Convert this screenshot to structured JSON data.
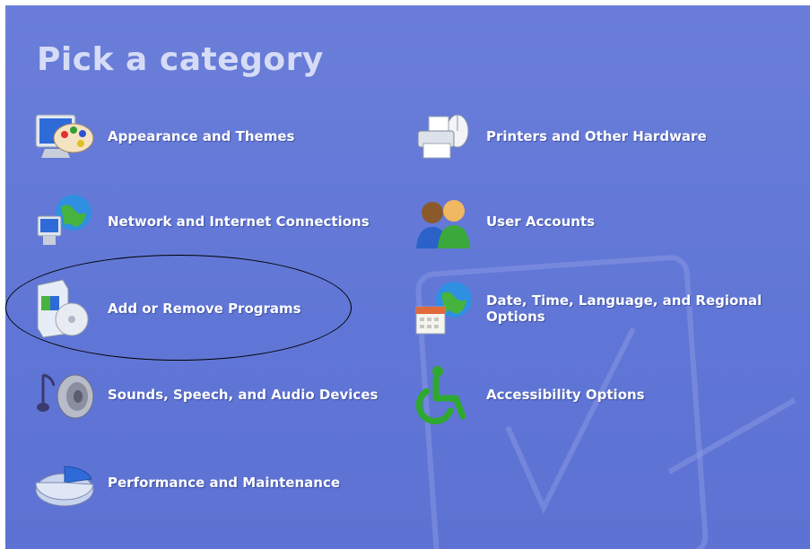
{
  "page": {
    "title": "Pick a category"
  },
  "categories": [
    {
      "id": "appearance",
      "label": "Appearance and Themes",
      "icon": "appearance-themes-icon"
    },
    {
      "id": "printers",
      "label": "Printers and Other Hardware",
      "icon": "printer-hardware-icon"
    },
    {
      "id": "network",
      "label": "Network and Internet Connections",
      "icon": "network-globe-icon"
    },
    {
      "id": "users",
      "label": "User Accounts",
      "icon": "user-accounts-icon"
    },
    {
      "id": "addremove",
      "label": "Add or Remove Programs",
      "icon": "add-remove-programs-icon"
    },
    {
      "id": "datetime",
      "label": "Date, Time, Language, and Regional Options",
      "icon": "date-time-globe-icon"
    },
    {
      "id": "sounds",
      "label": "Sounds, Speech, and Audio Devices",
      "icon": "sounds-speaker-icon"
    },
    {
      "id": "accessibility",
      "label": "Accessibility Options",
      "icon": "accessibility-wheelchair-icon"
    },
    {
      "id": "performance",
      "label": "Performance and Maintenance",
      "icon": "performance-pie-icon"
    }
  ],
  "colors": {
    "background": "#6076d6",
    "title": "#d6dcf6",
    "label": "#ffffff"
  }
}
